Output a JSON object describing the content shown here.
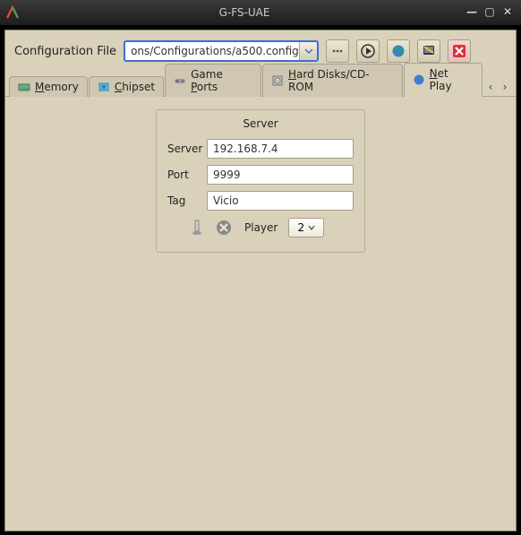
{
  "window": {
    "title": "G-FS-UAE"
  },
  "toolbar": {
    "config_label": "Configuration File",
    "config_value": "ons/Configurations/a500.config"
  },
  "tabs": [
    {
      "label_pre": "",
      "label_u": "M",
      "label_post": "emory",
      "icon": "memory-icon"
    },
    {
      "label_pre": "",
      "label_u": "C",
      "label_post": "hipset",
      "icon": "chip-icon"
    },
    {
      "label_pre": "Game ",
      "label_u": "P",
      "label_post": "orts",
      "icon": "gamepad-icon"
    },
    {
      "label_pre": "",
      "label_u": "H",
      "label_post": "ard Disks/CD-ROM",
      "icon": "hdd-icon"
    },
    {
      "label_pre": "",
      "label_u": "N",
      "label_post": "et Play",
      "icon": "globe-icon"
    }
  ],
  "netplay": {
    "group_title": "Server",
    "server_label": "Server",
    "server_value": "192.168.7.4",
    "port_label": "Port",
    "port_value": "9999",
    "tag_label": "Tag",
    "tag_value": "Vicio",
    "player_label": "Player",
    "player_value": "2"
  }
}
